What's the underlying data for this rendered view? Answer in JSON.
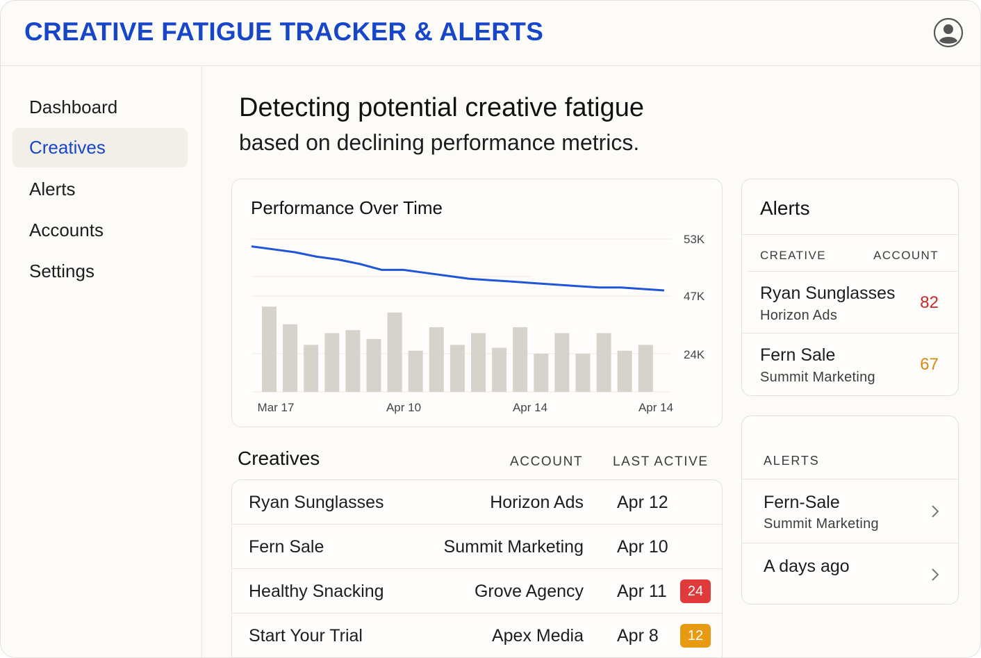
{
  "header": {
    "title": "CREATIVE FATIGUE TRACKER & ALERTS",
    "avatar_icon": "user-avatar-icon"
  },
  "sidebar": {
    "items": [
      {
        "label": "Dashboard",
        "active": false
      },
      {
        "label": "Creatives",
        "active": true
      },
      {
        "label": "Alerts",
        "active": false
      },
      {
        "label": "Accounts",
        "active": false
      },
      {
        "label": "Settings",
        "active": false
      }
    ]
  },
  "main": {
    "headline": "Detecting potential creative fatigue",
    "subline": "based on declining performance metrics."
  },
  "chart": {
    "title": "Performance Over Time"
  },
  "chart_data": {
    "type": "bar",
    "title": "Performance Over Time",
    "x_tick_labels": [
      "Mar 17",
      "Apr 10",
      "Apr 14",
      "Apr 14"
    ],
    "y_tick_labels": [
      "53K",
      "47K",
      "24K"
    ],
    "grid": true,
    "series": [
      {
        "type": "bar",
        "values": [
          29,
          23,
          16,
          20,
          21,
          18,
          27,
          14,
          22,
          16,
          20,
          15,
          22,
          13,
          20,
          13,
          20,
          14,
          16
        ]
      },
      {
        "type": "line",
        "color": "#1f55d6",
        "values": [
          49.5,
          48.5,
          47.5,
          46,
          45,
          43.5,
          41.5,
          41.5,
          40.5,
          39.5,
          38.5,
          38,
          37.5,
          37,
          36.5,
          36,
          35.5,
          35.5,
          35,
          34.5
        ]
      }
    ]
  },
  "creatives": {
    "title": "Creatives",
    "col_account": "ACCOUNT",
    "col_last_active": "LAST ACTIVE",
    "rows": [
      {
        "name": "Ryan Sunglasses",
        "account": "Horizon Ads",
        "last_active": "Apr 12",
        "badge": ""
      },
      {
        "name": "Fern Sale",
        "account": "Summit Marketing",
        "last_active": "Apr 10",
        "badge": ""
      },
      {
        "name": "Healthy Snacking",
        "account": "Grove Agency",
        "last_active": "Apr 11",
        "badge": "24",
        "badge_color": "#e03a3a"
      },
      {
        "name": "Start Your Trial",
        "account": "Apex Media",
        "last_active": "Apr 8",
        "badge": "12",
        "badge_color": "#e89a12"
      }
    ]
  },
  "alerts_panel": {
    "title": "Alerts",
    "col_creative": "CREATIVE",
    "col_account": "ACCOUNT",
    "items": [
      {
        "name": "Ryan Sunglasses",
        "account": "Horizon Ads",
        "score": "82",
        "color": "#c62828"
      },
      {
        "name": "Fern Sale",
        "account": "Summit Marketing",
        "score": "67",
        "color": "#d98a12"
      }
    ]
  },
  "alerts_feed": {
    "heading": "ALERTS",
    "items": [
      {
        "name": "Fern-Sale",
        "sub": "Summit Marketing"
      },
      {
        "name": "A days ago",
        "sub": ""
      }
    ]
  },
  "colors": {
    "brand": "#1746c8",
    "line": "#1f55d6",
    "bar": "#d6d3cd"
  }
}
